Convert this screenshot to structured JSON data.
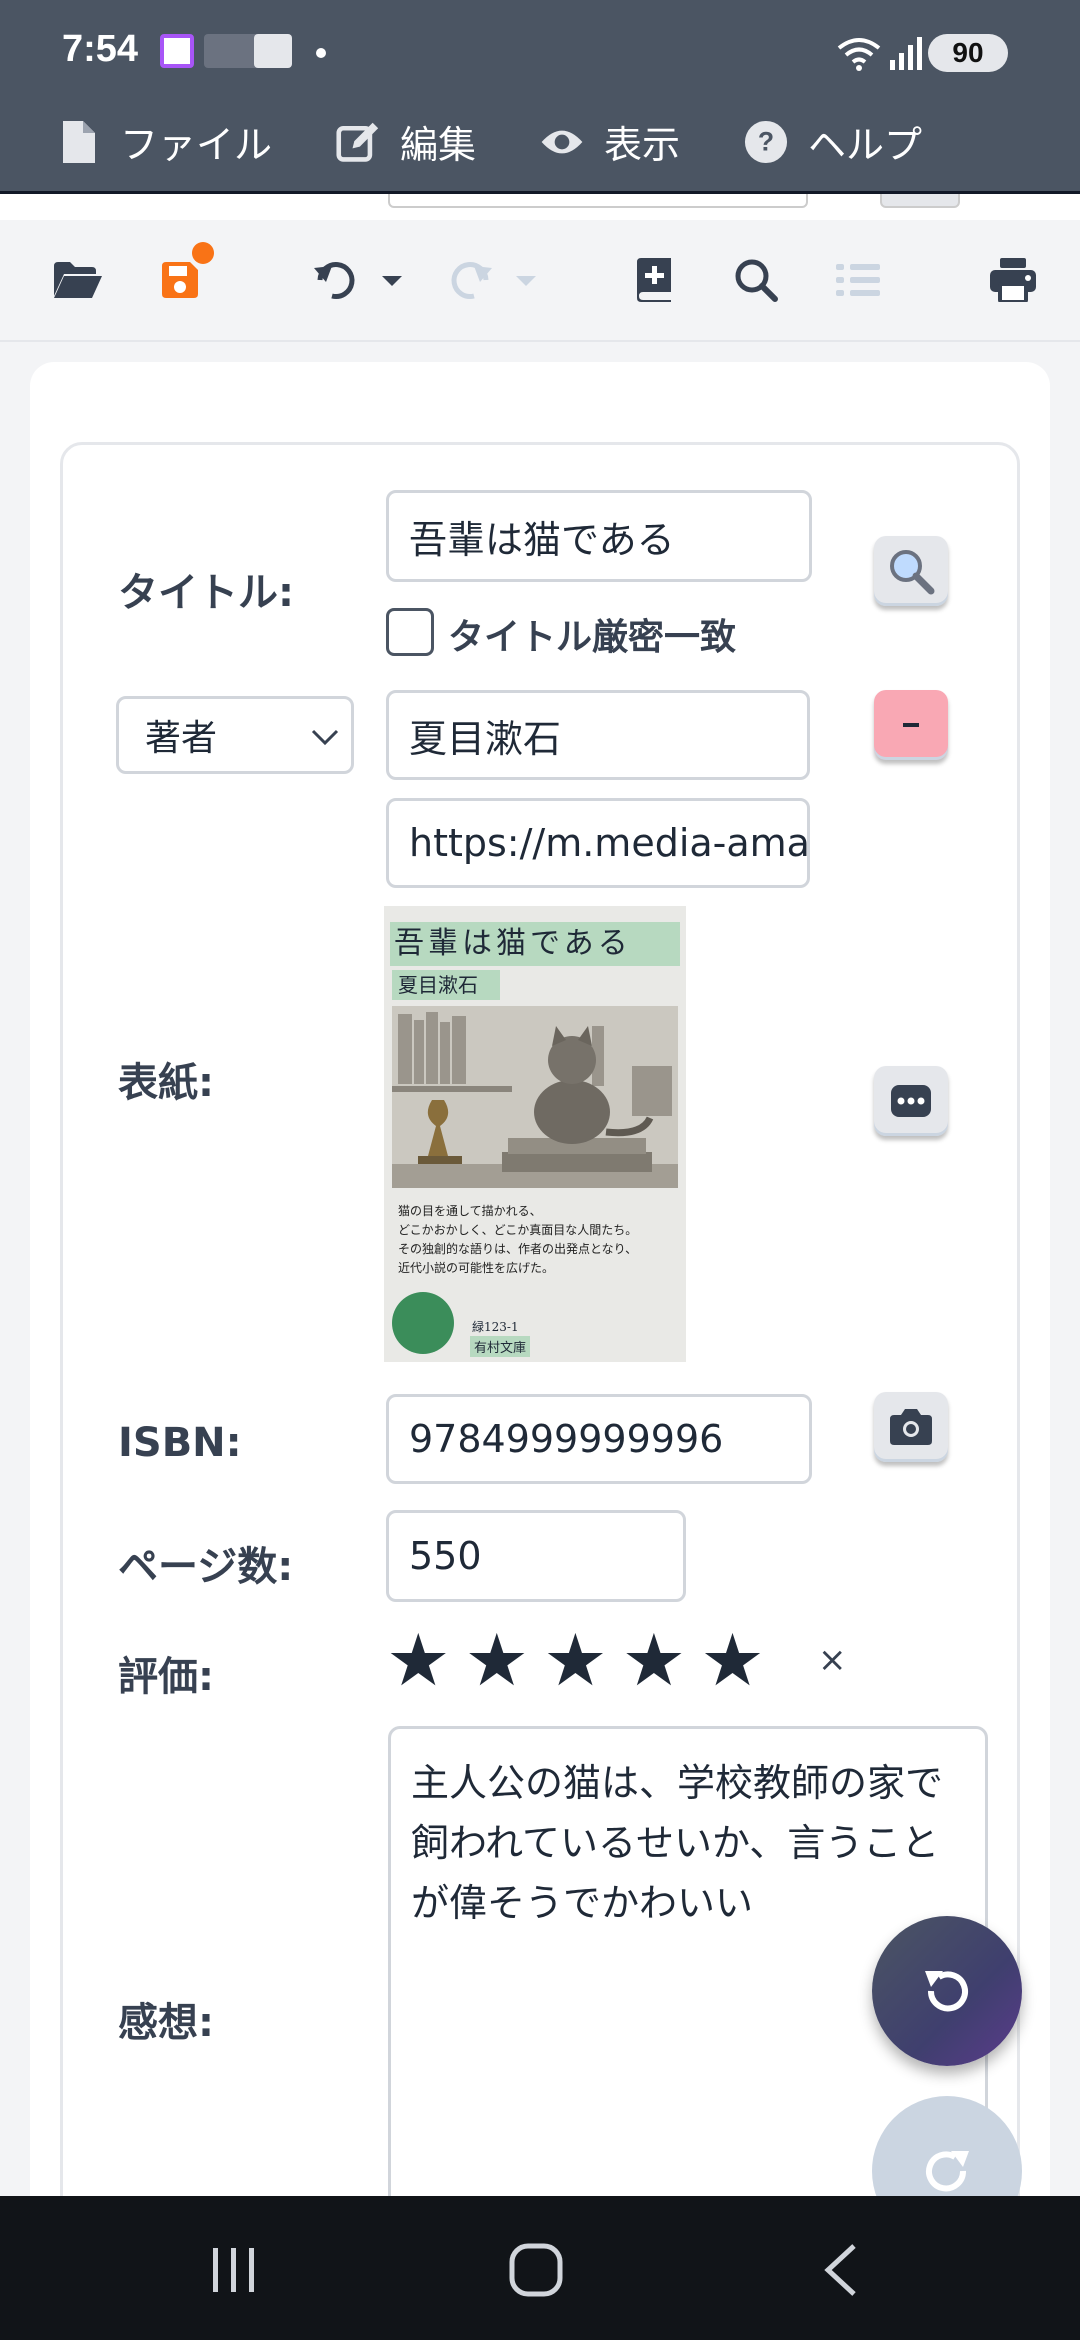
{
  "status_bar": {
    "time": "7:54",
    "battery": "90"
  },
  "menu": [
    {
      "label": "ファイル",
      "icon": "file-icon"
    },
    {
      "label": "編集",
      "icon": "edit-icon"
    },
    {
      "label": "表示",
      "icon": "eye-icon"
    },
    {
      "label": "ヘルプ",
      "icon": "help-icon"
    }
  ],
  "toolbar": {
    "icons": [
      "folder-open-icon",
      "save-icon",
      "undo-icon",
      "redo-icon",
      "add-book-icon",
      "search-icon",
      "list-icon",
      "print-icon"
    ]
  },
  "form": {
    "title_label": "タイトル:",
    "title_value": "吾輩は猫である",
    "exact_match_label": "タイトル厳密一致",
    "exact_match_checked": false,
    "person_role_selected": "著者",
    "author_value": "夏目漱石",
    "cover_url_value": "https://m.media-ama",
    "cover_label": "表紙:",
    "isbn_label": "ISBN:",
    "isbn_value": "9784999999996",
    "pages_label": "ページ数:",
    "pages_value": "550",
    "rating_label": "評価:",
    "rating_value": 5,
    "rating_max": 5,
    "rating_clear": "×",
    "review_label": "感想:",
    "review_value": "主人公の猫は、学校教師の家で飼われているせいか、言うことが偉そうでかわいい"
  },
  "cover": {
    "title": "吾輩は猫である",
    "author": "夏目漱石",
    "blurb": [
      "猫の目を通して描かれる、",
      "どこかおかしく、どこか真面目な人間たち。",
      "その独創的な語りは、作者の出発点となり、",
      "近代小説の可能性を広げた。"
    ],
    "catalog_no": "緑123-1",
    "publisher": "有村文庫"
  },
  "colors": {
    "header_bg": "#4b5563",
    "accent_orange": "#f97316",
    "remove_button": "#f9a8b4"
  }
}
